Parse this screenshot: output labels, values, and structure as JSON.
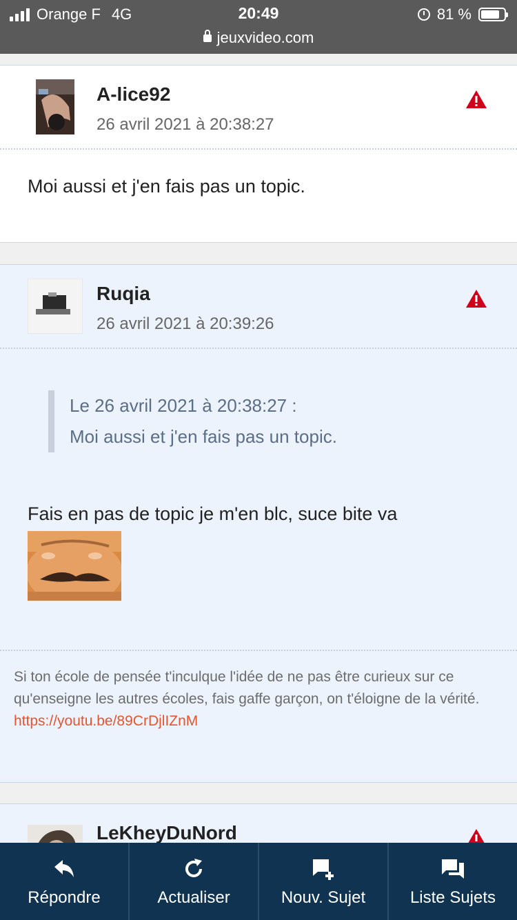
{
  "status_bar": {
    "carrier": "Orange F",
    "network": "4G",
    "time": "20:49",
    "battery": "81 %",
    "url": "jeuxvideo.com"
  },
  "posts": [
    {
      "author": "A-lice92",
      "date": "26 avril 2021 à 20:38:27",
      "message": "Moi aussi et j'en fais pas un topic."
    },
    {
      "author": "Ruqia",
      "date": "26 avril 2021 à 20:39:26",
      "quote_header": "Le 26 avril 2021 à 20:38:27 :",
      "quote_text": "Moi aussi et j'en fais pas un topic.",
      "message": "Fais en pas de topic je m'en blc, suce bite va",
      "signature": "Si ton école de pensée t'inculque l'idée de ne pas être curieux sur ce qu'enseigne les autres écoles, fais gaffe garçon, on t'éloigne de la vérité.",
      "signature_link": "https://youtu.be/89CrDjlIZnM"
    },
    {
      "author": "LeKheyDuNord"
    }
  ],
  "toolbar": {
    "reply": "Répondre",
    "refresh": "Actualiser",
    "new_topic": "Nouv. Sujet",
    "topic_list": "Liste Sujets"
  },
  "colors": {
    "toolbar_bg": "#0f3350",
    "warning": "#d0021b",
    "link": "#e8542c"
  }
}
